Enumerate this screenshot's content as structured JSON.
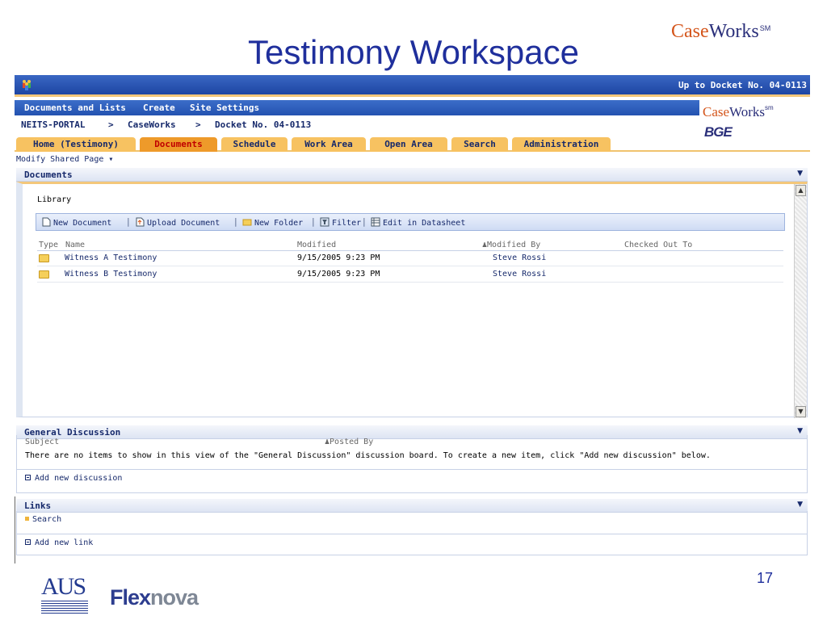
{
  "slide": {
    "title": "Testimony Workspace",
    "logo_top": {
      "part1": "Case",
      "part2": "Works",
      "mark": "SM"
    },
    "page_number": "17",
    "footer_logos": {
      "aus": "AUS",
      "flexnova_part1": "Flex",
      "flexnova_part2": "nova"
    }
  },
  "portal": {
    "top_right": "Up to Docket No. 04-0113",
    "menu": [
      "Documents and Lists",
      "Create",
      "Site Settings"
    ],
    "breadcrumb": [
      "NEITS-PORTAL",
      ">",
      "CaseWorks",
      ">",
      "Docket No. 04-0113"
    ],
    "logo": {
      "part1": "Case",
      "part2": "Works",
      "mark": "sm",
      "bge": "BGE"
    },
    "tabs": [
      {
        "label": "Home (Testimony)",
        "active": false
      },
      {
        "label": "Documents",
        "active": true
      },
      {
        "label": "Schedule",
        "active": false
      },
      {
        "label": "Work Area",
        "active": false
      },
      {
        "label": "Open Area",
        "active": false
      },
      {
        "label": "Search",
        "active": false
      },
      {
        "label": "Administration",
        "active": false
      }
    ],
    "modify_link": "Modify Shared Page ▾"
  },
  "documents": {
    "header": "Documents",
    "library_label": "Library",
    "toolbar": [
      "New Document",
      "Upload Document",
      "New Folder",
      "Filter",
      "Edit in Datasheet"
    ],
    "columns": [
      "Type",
      "Name",
      "Modified",
      "Modified By",
      "Checked Out To"
    ],
    "rows": [
      {
        "name": "Witness A Testimony",
        "modified": "9/15/2005 9:23 PM",
        "modified_by": "Steve Rossi"
      },
      {
        "name": "Witness B Testimony",
        "modified": "9/15/2005 9:23 PM",
        "modified_by": "Steve Rossi"
      }
    ]
  },
  "general_discussion": {
    "header": "General Discussion",
    "col_subject": "Subject",
    "col_posted_by": "Posted By",
    "empty_text": "There are no items to show in this view of the \"General Discussion\" discussion board. To create a new item, click \"Add new discussion\" below.",
    "add_link": "Add new discussion"
  },
  "links": {
    "header": "Links",
    "items": [
      "Search"
    ],
    "add_link": "Add new link"
  }
}
